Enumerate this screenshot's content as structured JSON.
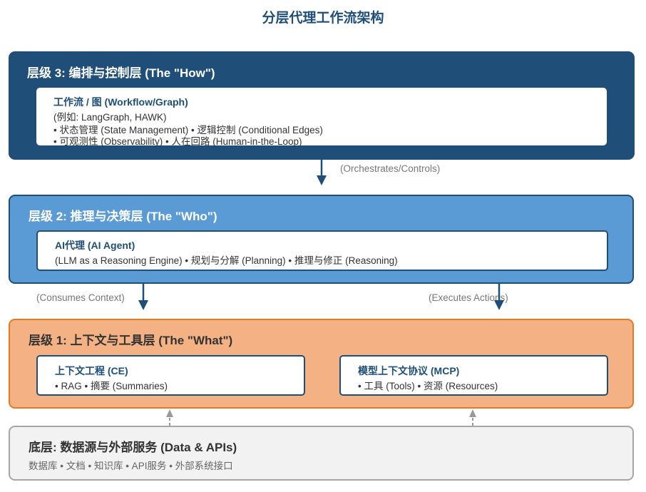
{
  "title": "分层代理工作流架构",
  "layer3": {
    "title": "层级 3: 编排与控制层 (The \"How\")",
    "card": {
      "title": "工作流 / 图 (Workflow/Graph)",
      "lines": [
        "(例如: LangGraph, HAWK)",
        "• 状态管理 (State Management) • 逻辑控制 (Conditional Edges)",
        "• 可观测性 (Observability) • 人在回路 (Human-in-the-Loop)"
      ]
    }
  },
  "layer2": {
    "title": "层级 2: 推理与决策层 (The \"Who\")",
    "card": {
      "title": "AI代理 (AI Agent)",
      "lines": [
        "(LLM as a Reasoning Engine) • 规划与分解 (Planning) • 推理与修正 (Reasoning)"
      ]
    }
  },
  "layer1": {
    "title": "层级 1: 上下文与工具层 (The \"What\")",
    "cards": [
      {
        "title": "上下文工程 (CE)",
        "lines": [
          "• RAG • 摘要 (Summaries)"
        ]
      },
      {
        "title": "模型上下文协议 (MCP)",
        "lines": [
          "• 工具 (Tools) • 资源 (Resources)"
        ]
      }
    ]
  },
  "base": {
    "title": "底层: 数据源与外部服务 (Data & APIs)",
    "subtitle": "数据库 • 文档 • 知识库 • API服务 • 外部系统接口"
  },
  "arrows": {
    "orchestrates": "(Orchestrates/Controls)",
    "consumes": "(Consumes Context)",
    "executes": "(Executes Actions)"
  },
  "colors": {
    "layer3": "#1f4e79",
    "layer2": "#5b9bd5",
    "layer1": "#f4b183",
    "base": "#f2f2f2",
    "arrow_dark": "#1f4e79",
    "arrow_grey": "#999999"
  }
}
